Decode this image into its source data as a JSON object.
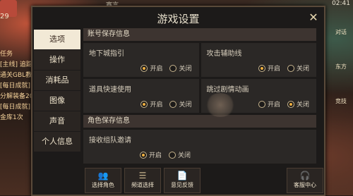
{
  "hud": {
    "level": "29",
    "top_title": "赛言",
    "time": "02:41",
    "quest_label": "任务",
    "quest_lines": [
      "[主线] 追踪要",
      "通关GBL教呀",
      "[每日成就]",
      "分解装备20次",
      "[每日成就]",
      "金库1次"
    ],
    "right_labels": [
      "对话",
      "东方",
      "竞技"
    ]
  },
  "dialog": {
    "title": "游戏设置",
    "close_icon": "close-icon"
  },
  "tabs": [
    {
      "label": "选项",
      "active": true
    },
    {
      "label": "操作",
      "active": false
    },
    {
      "label": "消耗品",
      "active": false
    },
    {
      "label": "图像",
      "active": false
    },
    {
      "label": "声音",
      "active": false
    },
    {
      "label": "个人信息",
      "active": false
    }
  ],
  "sections": {
    "account_title": "账号保存信息",
    "role_title": "角色保存信息"
  },
  "settings": {
    "dungeon_guide": {
      "label": "地下城指引",
      "on": "开启",
      "off": "关闭",
      "selected": "on"
    },
    "attack_assist": {
      "label": "攻击辅助线",
      "on": "开启",
      "off": "关闭",
      "selected": "on"
    },
    "quick_item": {
      "label": "道具快速使用",
      "on": "开启",
      "off": "关闭",
      "selected": "on"
    },
    "skip_cutscene": {
      "label": "跳过剧情动画",
      "on": "开启",
      "off": "关闭",
      "selected": "off"
    },
    "party_invite": {
      "label": "接收组队邀请",
      "on": "开启",
      "off": "关闭",
      "selected": "on"
    }
  },
  "bottom_buttons": {
    "select_role": "选择角色",
    "channel_select": "频道选择",
    "feedback": "意见反馈",
    "service_center": "客服中心"
  },
  "colors": {
    "accent": "#f0b040",
    "active_tab": "#f2e9d6"
  }
}
